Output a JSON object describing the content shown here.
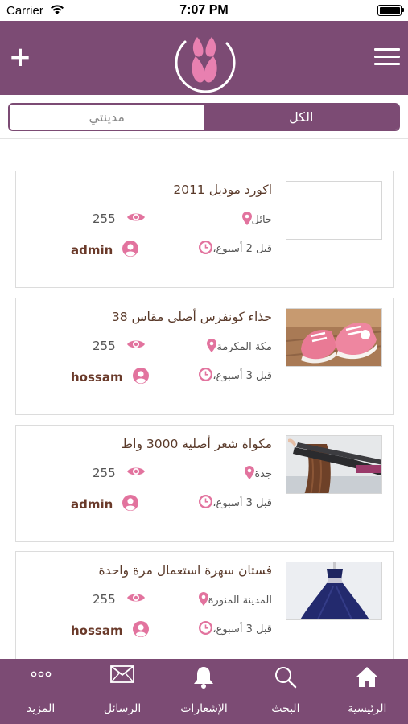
{
  "status_bar": {
    "carrier": "Carrier",
    "time": "7:07 PM"
  },
  "header": {
    "add_icon": "plus-icon",
    "menu_icon": "hamburger-menu-icon",
    "logo": "app-logo"
  },
  "segments": {
    "all": "الكل",
    "my_city": "مدينتي",
    "selected": "all"
  },
  "colors": {
    "primary": "#7c4b74",
    "accent_pink": "#e2739e",
    "text_brown": "#5a3a2a"
  },
  "listings": [
    {
      "title": "اكورد موديل 2011",
      "city": "حائل",
      "views": "255",
      "time": "قبل 2 أسبوع،",
      "user": "admin",
      "image": "empty"
    },
    {
      "title": "حذاء كونفرس أصلى مقاس 38",
      "city": "مكة المكرمة",
      "views": "255",
      "time": "قبل 3 أسبوع،",
      "user": "hossam",
      "image": "pink-sneakers"
    },
    {
      "title": "مكواة شعر أصلية 3000 واط",
      "city": "جدة",
      "views": "255",
      "time": "قبل 3 أسبوع،",
      "user": "admin",
      "image": "hair-straightener"
    },
    {
      "title": "فستان سهرة استعمال مرة واحدة",
      "city": "المدينة المنورة",
      "views": "255",
      "time": "قبل 3 أسبوع،",
      "user": "hossam",
      "image": "navy-evening-dress"
    }
  ],
  "tabs": [
    {
      "label": "الرئيسية",
      "icon": "home-icon"
    },
    {
      "label": "البحث",
      "icon": "search-icon"
    },
    {
      "label": "الإشعارات",
      "icon": "bell-icon"
    },
    {
      "label": "الرسائل",
      "icon": "envelope-icon"
    },
    {
      "label": "المزيد",
      "icon": "more-dots-icon"
    }
  ]
}
